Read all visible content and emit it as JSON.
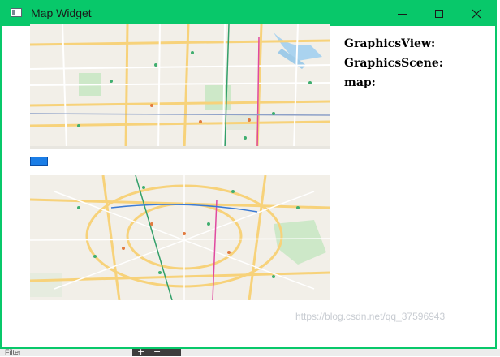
{
  "window": {
    "title": "Map Widget",
    "title_color": "#08c86a",
    "controls": [
      "minimize-icon",
      "maximize-icon",
      "close-icon"
    ]
  },
  "info": {
    "graphics_view": "GraphicsView:",
    "graphics_scene": "GraphicsScene:",
    "map": "map:"
  },
  "watermark": "https://blog.csdn.net/qq_37596943",
  "bottom_bar": {
    "filter_label": "Filter",
    "plus": "+",
    "minus": "−"
  }
}
